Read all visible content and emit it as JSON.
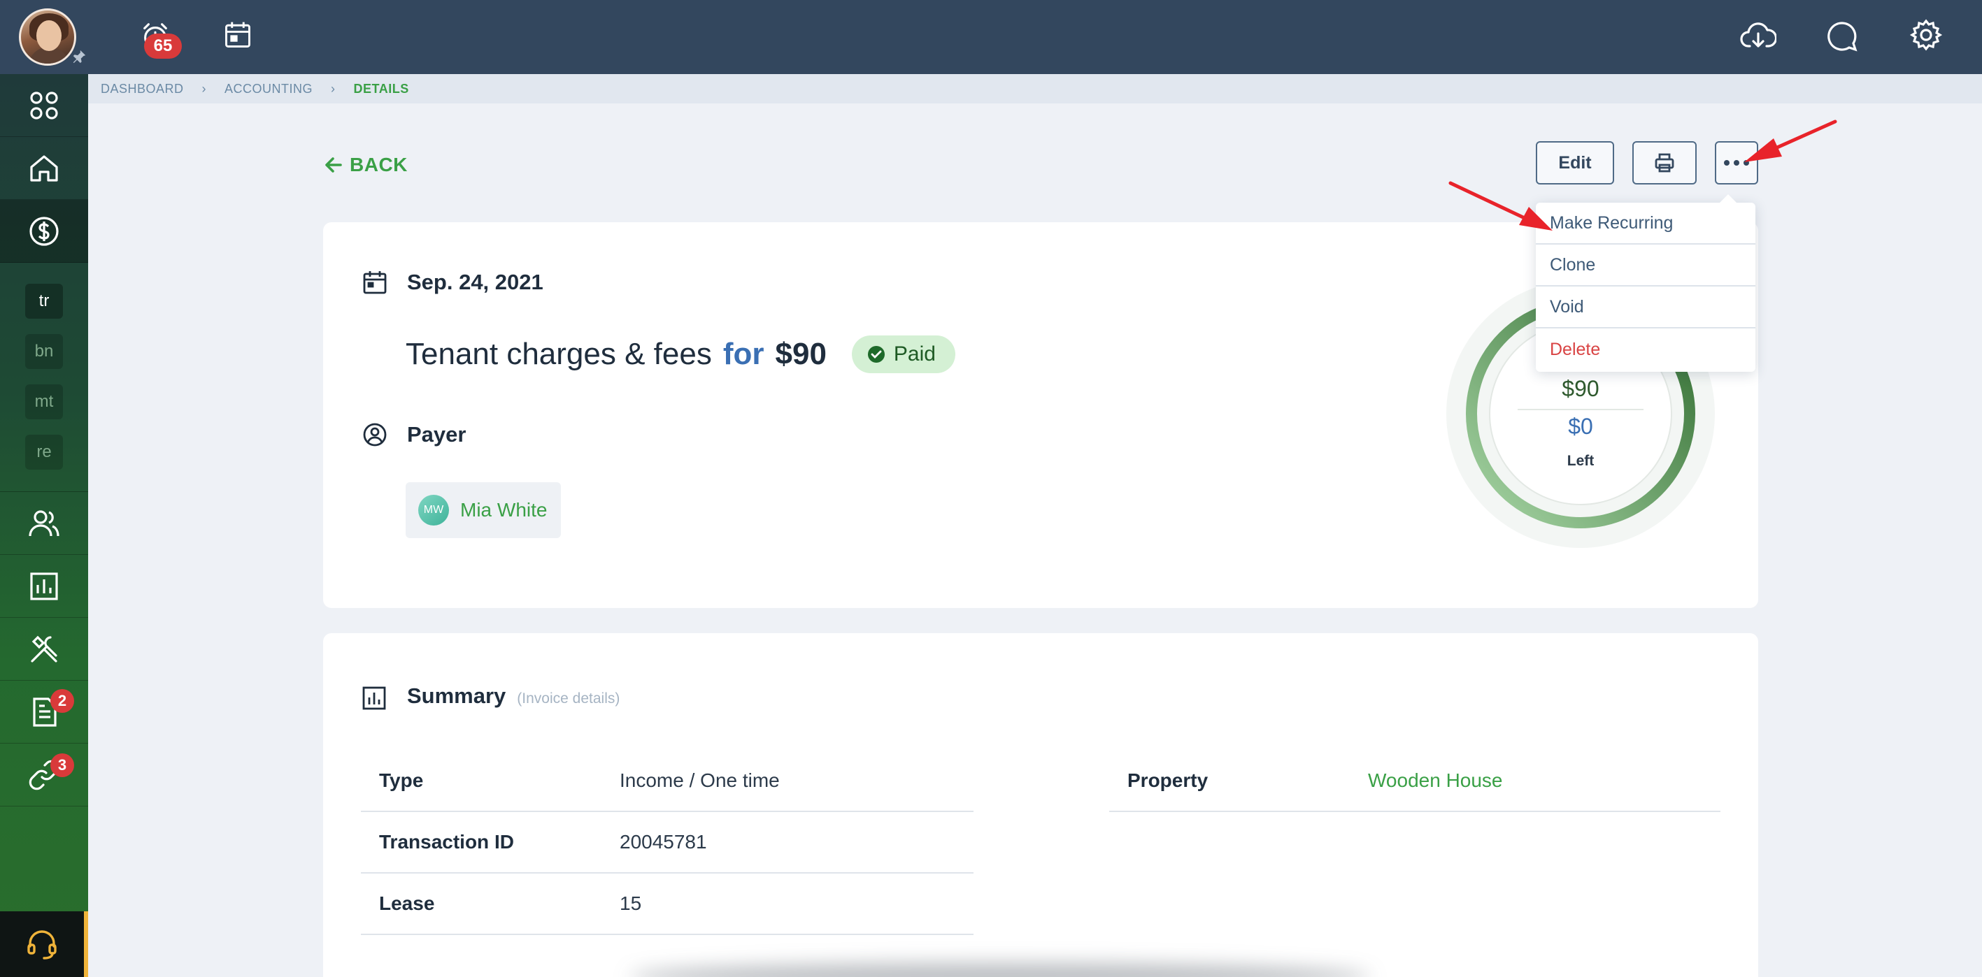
{
  "topbar": {
    "alerts_count": "65"
  },
  "sidebar": {
    "mini_items": [
      "tr",
      "bn",
      "mt",
      "re"
    ],
    "documents_badge": "2",
    "links_badge": "3"
  },
  "breadcrumb": {
    "items": [
      "DASHBOARD",
      "ACCOUNTING",
      "DETAILS"
    ]
  },
  "actions": {
    "back_label": "BACK",
    "edit_label": "Edit"
  },
  "menu": {
    "items": [
      "Make Recurring",
      "Clone",
      "Void",
      "Delete"
    ]
  },
  "transaction": {
    "date": "Sep. 24, 2021",
    "title": "Tenant charges & fees",
    "for_word": "for",
    "amount": "$90",
    "status": "Paid",
    "payer_heading": "Payer",
    "payer_initials": "MW",
    "payer_name": "Mia White"
  },
  "gauge": {
    "paid_amount": "$90",
    "left_amount": "$0",
    "left_label": "Left",
    "progress_fraction": 1.0
  },
  "summary": {
    "title": "Summary",
    "subtitle": "(Invoice details)",
    "left_rows": [
      {
        "label": "Type",
        "value": "Income / One time"
      },
      {
        "label": "Transaction ID",
        "value": "20045781"
      },
      {
        "label": "Lease",
        "value": "15"
      }
    ],
    "right_rows": [
      {
        "label": "Property",
        "value": "Wooden House"
      }
    ]
  },
  "colors": {
    "accent_green": "#3aa046",
    "topbar": "#33475e",
    "danger": "#d94444",
    "annotation_arrow": "#e8232a"
  }
}
